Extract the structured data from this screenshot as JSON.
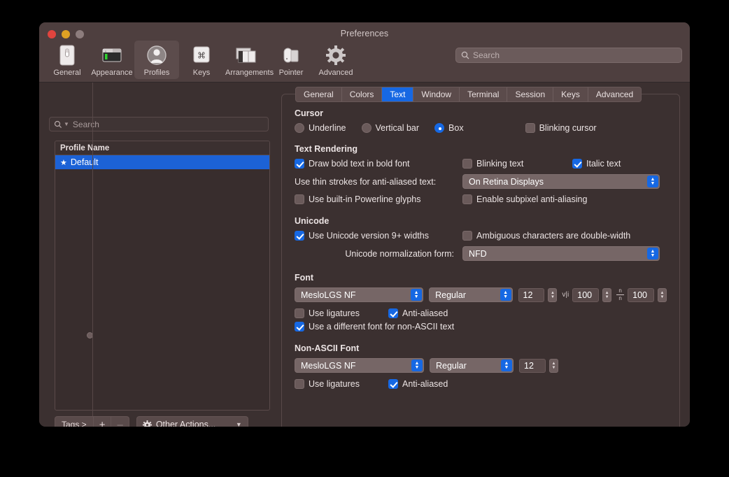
{
  "window": {
    "title": "Preferences",
    "traffic_lights": [
      "close-red",
      "minimize-yellow",
      "zoom-gray"
    ]
  },
  "toolbar": {
    "items": [
      {
        "label": "General",
        "icon": "general-icon",
        "selected": false
      },
      {
        "label": "Appearance",
        "icon": "appearance-icon",
        "selected": false
      },
      {
        "label": "Profiles",
        "icon": "profiles-icon",
        "selected": true
      },
      {
        "label": "Keys",
        "icon": "keys-icon",
        "selected": false
      },
      {
        "label": "Arrangements",
        "icon": "arrangements-icon",
        "selected": false
      },
      {
        "label": "Pointer",
        "icon": "pointer-icon",
        "selected": false
      },
      {
        "label": "Advanced",
        "icon": "advanced-icon",
        "selected": false
      }
    ],
    "search": {
      "placeholder": "Search",
      "value": "",
      "icon": "search-icon"
    }
  },
  "sidebar": {
    "search": {
      "placeholder": "Search",
      "value": "",
      "icon": "search-icon"
    },
    "list": {
      "header": "Profile Name",
      "rows": [
        {
          "name": "Default",
          "starred": true,
          "selected": true
        }
      ]
    },
    "toolbar": {
      "tags_label": "Tags >",
      "add_label": "+",
      "remove_label": "–",
      "other_actions_label": "Other Actions...",
      "other_actions_icon": "gear-icon",
      "other_actions_chevron": "chevron-down-icon"
    }
  },
  "tabs": [
    {
      "label": "General",
      "active": false
    },
    {
      "label": "Colors",
      "active": false
    },
    {
      "label": "Text",
      "active": true
    },
    {
      "label": "Window",
      "active": false
    },
    {
      "label": "Terminal",
      "active": false
    },
    {
      "label": "Session",
      "active": false
    },
    {
      "label": "Keys",
      "active": false
    },
    {
      "label": "Advanced",
      "active": false
    }
  ],
  "sections": {
    "cursor": {
      "title": "Cursor",
      "underline_label": "Underline",
      "underline_selected": false,
      "vertical_bar_label": "Vertical bar",
      "vertical_bar_selected": false,
      "box_label": "Box",
      "box_selected": true,
      "blinking_cursor_label": "Blinking cursor",
      "blinking_cursor_checked": false
    },
    "text_rendering": {
      "title": "Text Rendering",
      "draw_bold_label": "Draw bold text in bold font",
      "draw_bold_checked": true,
      "blinking_text_label": "Blinking text",
      "blinking_text_checked": false,
      "italic_text_label": "Italic text",
      "italic_text_checked": true,
      "thin_strokes_label": "Use thin strokes for anti-aliased text:",
      "thin_strokes_value": "On Retina Displays",
      "powerline_label": "Use built-in Powerline glyphs",
      "powerline_checked": false,
      "subpixel_label": "Enable subpixel anti-aliasing",
      "subpixel_checked": false
    },
    "unicode": {
      "title": "Unicode",
      "version9_label": "Use Unicode version 9+ widths",
      "version9_checked": true,
      "ambiguous_label": "Ambiguous characters are double-width",
      "ambiguous_checked": false,
      "normalization_label": "Unicode normalization form:",
      "normalization_value": "NFD"
    },
    "font": {
      "title": "Font",
      "family_value": "MesloLGS NF",
      "style_value": "Regular",
      "size_value": "12",
      "horizontal_spacing_icon": "horizontal-spacing-icon",
      "horizontal_spacing_value": "100",
      "vertical_spacing_icon": "vertical-spacing-icon",
      "vertical_spacing_value": "100",
      "ligatures_label": "Use ligatures",
      "ligatures_checked": false,
      "antialiased_label": "Anti-aliased",
      "antialiased_checked": true,
      "different_font_label": "Use a different font for non-ASCII text",
      "different_font_checked": true
    },
    "non_ascii_font": {
      "title": "Non-ASCII Font",
      "family_value": "MesloLGS NF",
      "style_value": "Regular",
      "size_value": "12",
      "ligatures_label": "Use ligatures",
      "ligatures_checked": false,
      "antialiased_label": "Anti-aliased",
      "antialiased_checked": true
    }
  },
  "colors": {
    "accent_blue": "#1668e3",
    "selection_blue": "#1c62d6",
    "window_bg": "#3b3030",
    "titlebar_bg": "#4e3f3f",
    "control_bg": "#766666",
    "traffic_red": "#e0443e",
    "traffic_yellow": "#dea123",
    "traffic_gray": "#8d7d7d"
  }
}
